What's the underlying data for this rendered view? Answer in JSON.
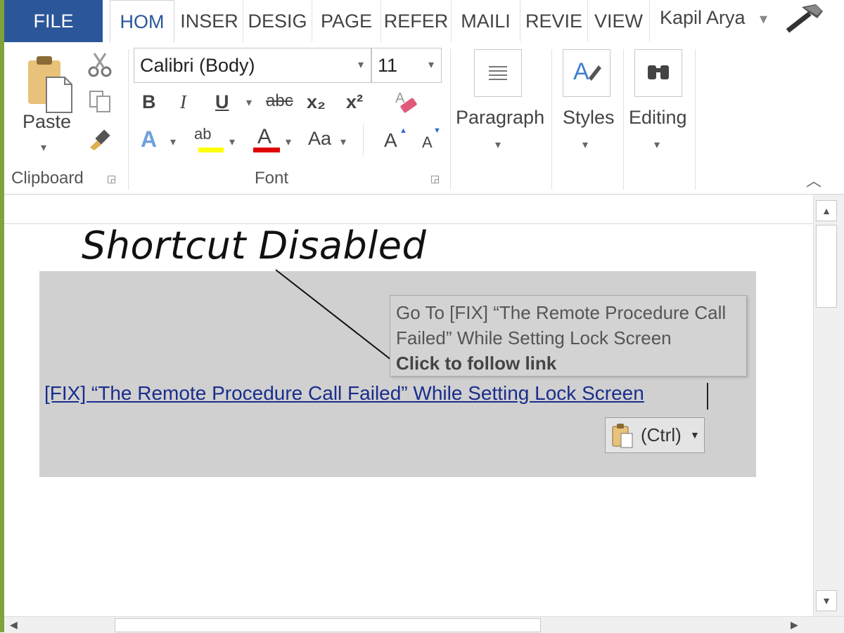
{
  "tabs": {
    "file": "FILE",
    "home": "HOM",
    "insert": "INSER",
    "design": "DESIG",
    "page": "PAGE",
    "references": "REFER",
    "mailings": "MAILI",
    "review": "REVIE",
    "view": "VIEW"
  },
  "user": {
    "name": "Kapil Arya"
  },
  "ribbon": {
    "clipboard": {
      "paste_label": "Paste",
      "group_label": "Clipboard"
    },
    "font": {
      "font_name": "Calibri (Body)",
      "font_size": "11",
      "bold": "B",
      "italic": "I",
      "underline": "U",
      "strike": "abc",
      "subscript": "x₂",
      "superscript": "x²",
      "text_effects": "A",
      "highlight": "ab",
      "font_color": "A",
      "change_case": "Aa",
      "grow_font": "A",
      "shrink_font": "A",
      "group_label": "Font"
    },
    "paragraph_label": "Paragraph",
    "styles_label": "Styles",
    "editing_label": "Editing"
  },
  "document": {
    "title": "Shortcut Disabled",
    "tooltip_line1": "Go To [FIX] “The Remote Procedure Call",
    "tooltip_line2": "Failed” While Setting Lock Screen",
    "tooltip_bold": "Click to follow link",
    "hyperlink_text": "[FIX] “The Remote Procedure Call Failed” While Setting Lock Screen",
    "paste_options_label": "(Ctrl)"
  },
  "colors": {
    "file_tab": "#2b579a",
    "highlight_yellow": "#ffff00",
    "font_red": "#e00000",
    "hyperlink": "#1a2d8c"
  }
}
